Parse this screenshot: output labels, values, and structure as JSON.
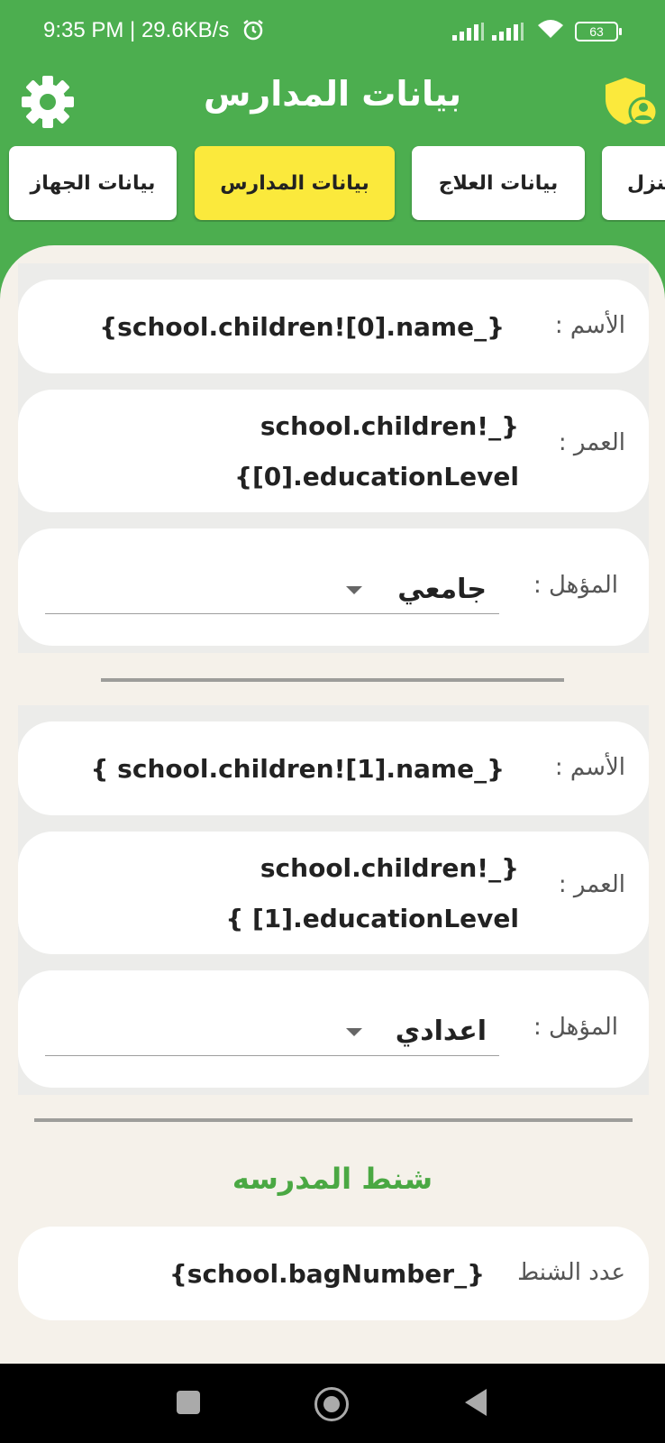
{
  "status_bar": {
    "time": "9:35 PM | 29.6KB/s",
    "battery": "63"
  },
  "app_bar": {
    "title": "بيانات المدارس"
  },
  "tabs": [
    {
      "label": "بيانات الجهاز",
      "active": false
    },
    {
      "label": "بيانات المدارس",
      "active": true
    },
    {
      "label": "بيانات العلاج",
      "active": false
    },
    {
      "label": "منزل",
      "active": false
    }
  ],
  "children": [
    {
      "name_label": "الأسم :",
      "name_value": "{school.children![0].name_}",
      "age_label": "العمر :",
      "age_value_line1": "school.children!_}",
      "age_value_line2": "{[0].educationLevel",
      "qualification_label": "المؤهل :",
      "qualification_value": "جامعي"
    },
    {
      "name_label": "الأسم :",
      "name_value": "{ school.children![1].name_}",
      "age_label": "العمر :",
      "age_value_line1": "school.children!_}",
      "age_value_line2": "{ [1].educationLevel",
      "qualification_label": "المؤهل :",
      "qualification_value": "اعدادي"
    }
  ],
  "bags_section": {
    "title": "شنط المدرسه",
    "count_label": "عدد الشنط",
    "count_value": "{school.bagNumber_}"
  },
  "colors": {
    "primary_green": "#4cae4f",
    "active_tab_yellow": "#fbe93c",
    "background_cream": "#f5f1ea",
    "section_title_green": "#4aa843"
  },
  "icons": {
    "settings": "gear-icon",
    "account": "shield-user-icon",
    "alarm": "alarm-icon",
    "wifi": "wifi-icon",
    "signal": "signal-icon"
  }
}
